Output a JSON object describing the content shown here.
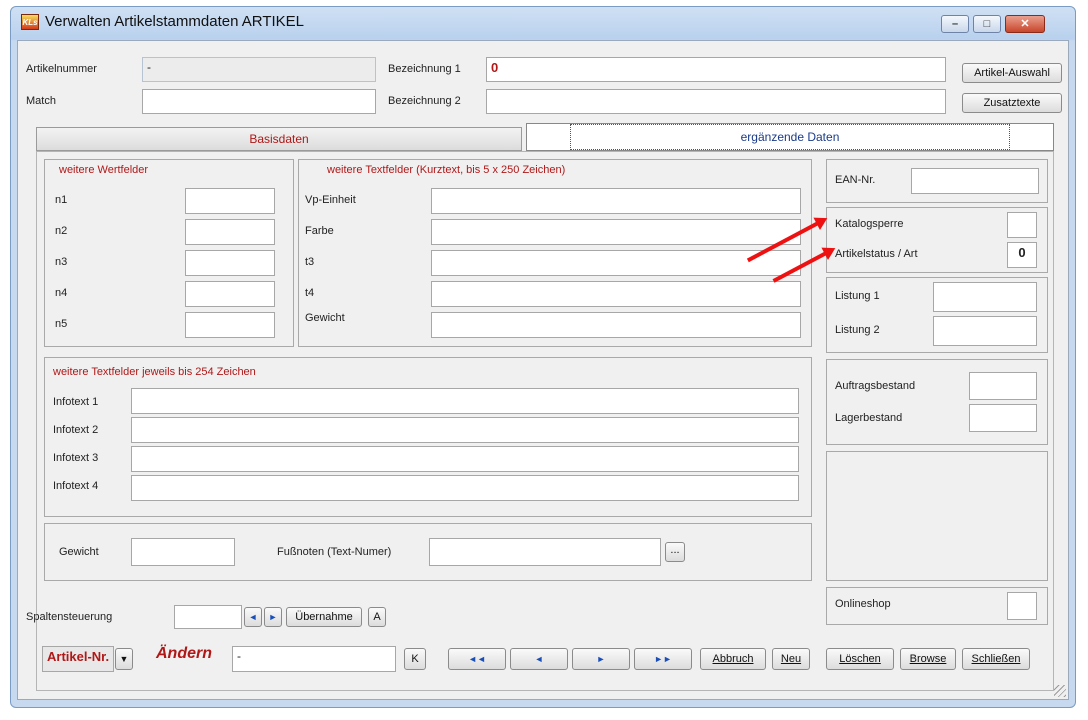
{
  "window": {
    "title": "Verwalten Artikelstammdaten   ARTIKEL",
    "app_icon_text": "KLs",
    "controls": {
      "minimize": "–",
      "maximize": "□",
      "close": "✕"
    }
  },
  "header": {
    "artikelnummer_label": "Artikelnummer",
    "artikelnummer_value": "-",
    "match_label": "Match",
    "match_value": "",
    "bez1_label": "Bezeichnung 1",
    "bez1_value": "0",
    "bez2_label": "Bezeichnung 2",
    "bez2_value": "",
    "artikel_auswahl_button": "Artikel-Auswahl",
    "zusatztexte_button": "Zusatztexte"
  },
  "tabs": [
    {
      "label": "Basisdaten",
      "active": false
    },
    {
      "label": "ergänzende Daten",
      "active": true
    }
  ],
  "wertfelder": {
    "title": "weitere Wertfelder",
    "fields": [
      {
        "label": "n1",
        "value": ""
      },
      {
        "label": "n2",
        "value": ""
      },
      {
        "label": "n3",
        "value": ""
      },
      {
        "label": "n4",
        "value": ""
      },
      {
        "label": "n5",
        "value": ""
      }
    ]
  },
  "textfelder": {
    "title": "weitere Textfelder (Kurztext, bis 5 x  250 Zeichen)",
    "fields": [
      {
        "label": "Vp-Einheit",
        "value": ""
      },
      {
        "label": "Farbe",
        "value": ""
      },
      {
        "label": "t3",
        "value": ""
      },
      {
        "label": "t4",
        "value": ""
      },
      {
        "label": "Gewicht",
        "value": ""
      }
    ]
  },
  "infotexte": {
    "title": "weitere Textfelder  jeweils bis 254 Zeichen",
    "fields": [
      {
        "label": "Infotext 1",
        "value": ""
      },
      {
        "label": "Infotext 2",
        "value": ""
      },
      {
        "label": "Infotext 3",
        "value": ""
      },
      {
        "label": "Infotext 4",
        "value": ""
      }
    ]
  },
  "gewicht_row": {
    "gewicht_label": "Gewicht",
    "gewicht_value": "",
    "fussnoten_label": "Fußnoten (Text-Numer)",
    "fussnoten_value": "",
    "ellipsis_button": "..."
  },
  "spalten": {
    "label": "Spaltensteuerung",
    "value": "",
    "prev": "◄",
    "next": "►",
    "uebernahme_button": "Übernahme",
    "a_button": "A"
  },
  "right_panel": {
    "ean_label": "EAN-Nr.",
    "ean_value": "",
    "katalogsperre_label": "Katalogsperre",
    "katalogsperre_value": "",
    "artikelstatus_label": "Artikelstatus / Art",
    "artikelstatus_value": "0",
    "listung1_label": "Listung 1",
    "listung1_value": "",
    "listung2_label": "Listung 2",
    "listung2_value": "",
    "auftragsbestand_label": "Auftragsbestand",
    "auftragsbestand_value": "",
    "lagerbestand_label": "Lagerbestand",
    "lagerbestand_value": "",
    "onlineshop_label": "Onlineshop",
    "onlineshop_value": ""
  },
  "bottom": {
    "key_select": "Artikel-Nr.",
    "mode_label": "Ändern",
    "search_value": "-",
    "k_button": "K",
    "first": "◄◄",
    "prev": "◄",
    "next": "►",
    "last": "►►",
    "abbruch": "Abbruch",
    "neu": "Neu",
    "loeschen": "Löschen",
    "browse": "Browse",
    "schliessen": "Schließen"
  },
  "colors": {
    "accent_red": "#b01818",
    "annotation_arrow": "#ee1111"
  }
}
